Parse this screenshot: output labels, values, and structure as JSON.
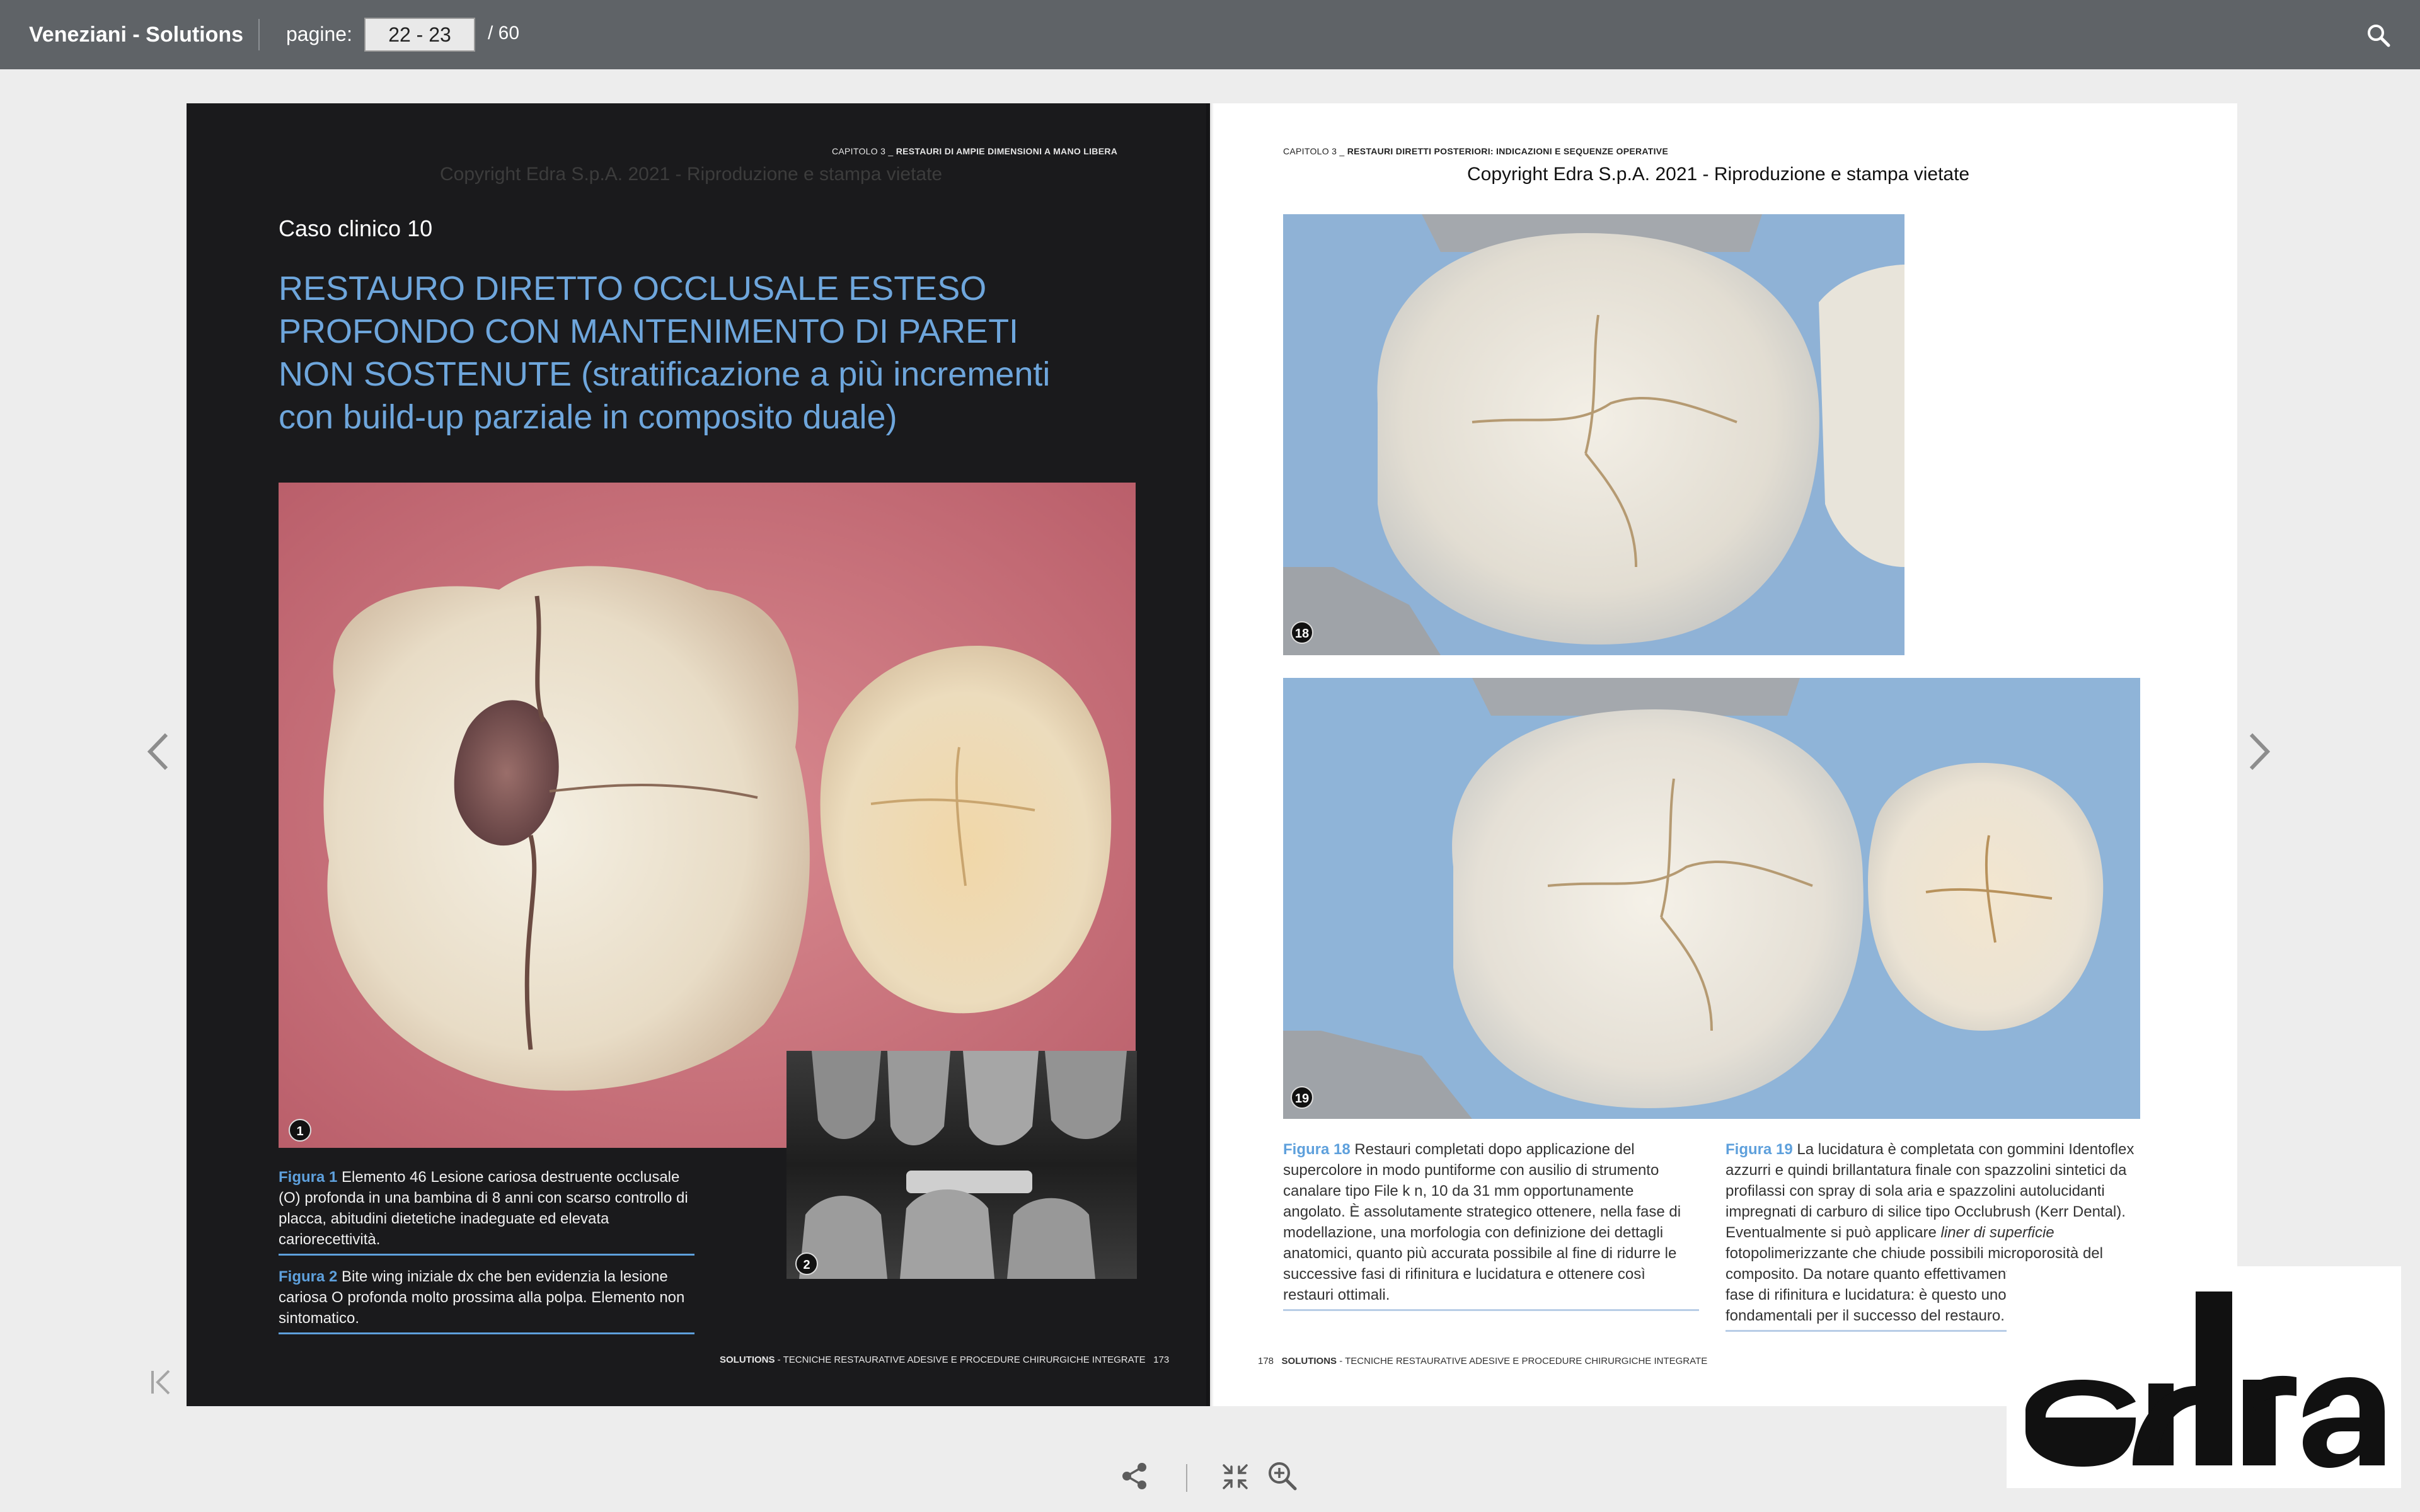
{
  "toolbar": {
    "title": "Veneziani - Solutions",
    "pages_label": "pagine:",
    "page_value": "22 - 23",
    "total_pages": "/  60",
    "search_icon": "search-icon"
  },
  "left_page": {
    "running_head_chapter": "CAPITOLO 3 _",
    "running_head_title": "RESTAURI DI AMPIE DIMENSIONI A MANO LIBERA",
    "copyright": "Copyright Edra S.p.A. 2021 - Riproduzione e stampa vietate",
    "case_label": "Caso clinico 10",
    "title_upper": "RESTAURO DIRETTO OCCLUSALE ESTESO PROFONDO CON MANTENIMENTO DI PARETI NON SOSTENUTE",
    "title_rest": " (stratificazione a più incrementi con build-up parziale in composito duale)",
    "fig1_num": "1",
    "fig2_num": "2",
    "caption1_label": "Figura 1",
    "caption1_text": " Elemento 46 Lesione cariosa destruente occlusale (O) profonda in una bambina di 8 anni con scarso controllo di placca, abitudini dietetiche inadeguate ed elevata cariorecettività.",
    "caption2_label": "Figura 2",
    "caption2_text": " Bite wing iniziale dx che ben evidenzia la lesione cariosa O profonda molto prossima alla polpa. Elemento non sintomatico.",
    "footer_book": "SOLUTIONS",
    "footer_subtitle": " - TECNICHE RESTAURATIVE ADESIVE E PROCEDURE CHIRURGICHE INTEGRATE",
    "page_number": "173"
  },
  "right_page": {
    "running_head_chapter": "CAPITOLO 3 _",
    "running_head_title": "RESTAURI DIRETTI POSTERIORI: INDICAZIONI E SEQUENZE OPERATIVE",
    "copyright": "Copyright Edra S.p.A. 2021 - Riproduzione e stampa vietate",
    "fig18_num": "18",
    "fig19_num": "19",
    "caption18_label": "Figura 18",
    "caption18_text": " Restauri completati dopo applicazione del supercolore in modo puntiforme con ausilio di strumento canalare tipo File k n, 10 da 31 mm opportunamente angolato. È assolutamente strategico ottenere, nella fase di modellazione, una morfologia con definizione dei dettagli anatomici, quanto più accurata possibile al fine di ridurre le successive fasi di rifinitura e lucidatura e ottenere così restauri ottimali.",
    "caption19_label": "Figura 19",
    "caption19_text_a": " La lucidatura è completata con gommini Identoflex azzurri e quindi brillantatura finale con spazzolini sintetici da profilassi con spray di sola aria e spazzolini autolucidanti impregnati di carburo di silice tipo Occlubrush (Kerr Dental). Eventualmente si può applicare ",
    "caption19_italic": "liner di superficie",
    "caption19_text_b": " fotopolimerizzante che chiude possibili microporosità del composito. Da notare quanto effettivamente sia limitata la fase di rifinitura e lucidatura: è questo uno degli elementi fondamentali per il successo del restauro.",
    "page_number": "178",
    "footer_book": "SOLUTIONS",
    "footer_subtitle": " - TECNICHE RESTAURATIVE ADESIVE E PROCEDURE CHIRURGICHE INTEGRATE"
  },
  "logo": {
    "text": "edra"
  },
  "icons": {
    "prev": "chevron-left-icon",
    "next": "chevron-right-icon",
    "first": "first-page-icon",
    "share": "share-icon",
    "fullscreen": "exit-fullscreen-icon",
    "zoom": "zoom-in-icon"
  },
  "colors": {
    "toolbar": "#5f6367",
    "accent_blue": "#6ea6dc",
    "left_page_bg": "#1a1a1c"
  }
}
